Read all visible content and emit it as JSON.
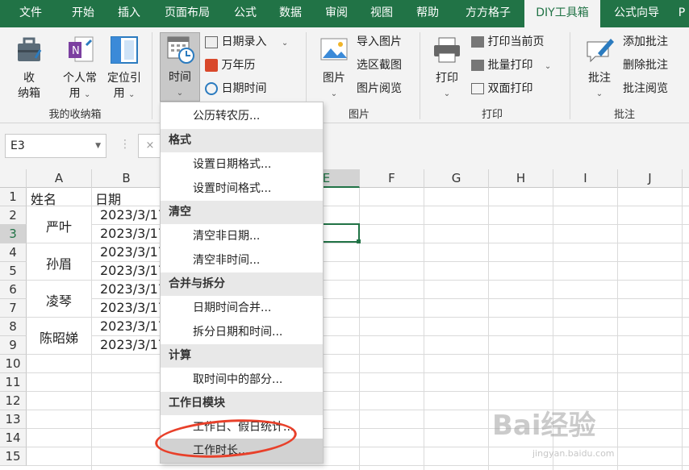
{
  "tabs": [
    {
      "label": "文件"
    },
    {
      "label": "开始"
    },
    {
      "label": "插入"
    },
    {
      "label": "页面布局"
    },
    {
      "label": "公式"
    },
    {
      "label": "数据"
    },
    {
      "label": "审阅"
    },
    {
      "label": "视图"
    },
    {
      "label": "帮助"
    },
    {
      "label": "方方格子"
    },
    {
      "label": "DIY工具箱",
      "active": true
    },
    {
      "label": "公式向导"
    },
    {
      "label": "P"
    }
  ],
  "ribbon": {
    "storage": {
      "box_l1": "收",
      "box_l2": "纳箱",
      "personal_l1": "个人常",
      "personal_l2": "用",
      "locate_l1": "定位引",
      "locate_l2": "用",
      "group": "我的收纳箱"
    },
    "time": {
      "label": "时间",
      "date_entry": "日期录入",
      "calendar": "万年历",
      "datetime": "日期时间"
    },
    "picture": {
      "label": "图片",
      "import": "导入图片",
      "screenshot": "选区截图",
      "browse": "图片阅览",
      "group": "图片"
    },
    "print": {
      "label": "打印",
      "current_page": "打印当前页",
      "batch": "批量打印",
      "duplex": "双面打印",
      "group": "打印"
    },
    "comment": {
      "label": "批注",
      "add": "添加批注",
      "delete": "删除批注",
      "browse": "批注阅览",
      "group": "批注"
    }
  },
  "namebox": "E3",
  "fx": "×",
  "columns": [
    "A",
    "B",
    "E",
    "F",
    "G",
    "H",
    "I",
    "J"
  ],
  "rows": [
    "1",
    "2",
    "3",
    "4",
    "5",
    "6",
    "7",
    "8",
    "9",
    "10",
    "11",
    "12",
    "13",
    "14",
    "15"
  ],
  "cells": {
    "a1": "姓名",
    "b1": "日期",
    "names": [
      "严叶",
      "孙眉",
      "凌琴",
      "陈昭娣"
    ],
    "dates": [
      "2023/3/17",
      "2023/3/17",
      "2023/3/17",
      "2023/3/17",
      "2023/3/17",
      "2023/3/17",
      "2023/3/17",
      "2023/3/17"
    ]
  },
  "menu": {
    "lunar": "公历转农历...",
    "h_format": "格式",
    "set_date_format": "设置日期格式...",
    "set_time_format": "设置时间格式...",
    "h_clear": "清空",
    "clear_non_date": "清空非日期...",
    "clear_non_time": "清空非时间...",
    "h_merge": "合并与拆分",
    "merge": "日期时间合并...",
    "split": "拆分日期和时间...",
    "h_calc": "计算",
    "extract": "取时间中的部分...",
    "h_workday": "工作日模块",
    "workday_stats": "工作日、假日统计...",
    "work_hours": "工作时长..."
  },
  "watermark": "Bai经验",
  "watermark_url": "jingyan.baidu.com"
}
